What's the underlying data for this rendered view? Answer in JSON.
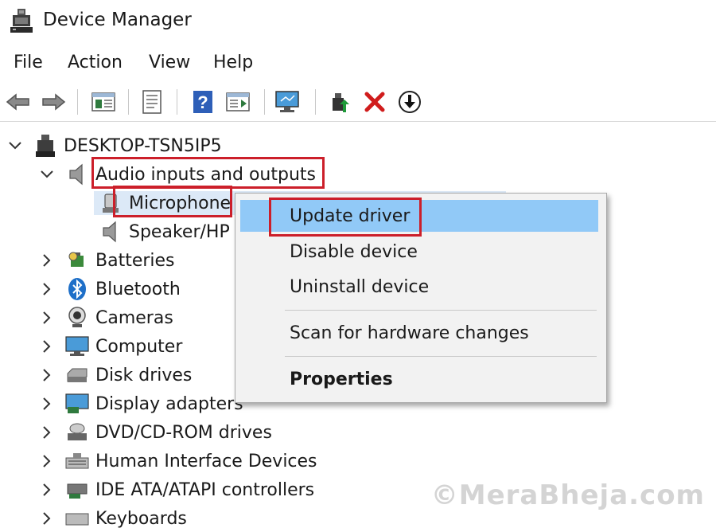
{
  "window": {
    "title": "Device Manager"
  },
  "menu": {
    "items": [
      "File",
      "Action",
      "View",
      "Help"
    ]
  },
  "toolbar": {
    "buttons": [
      "back-icon",
      "forward-icon",
      "show-hide-console-tree-icon",
      "properties-icon",
      "help-icon",
      "action-pane-icon",
      "monitor-icon",
      "update-driver-icon",
      "uninstall-icon",
      "disable-icon"
    ]
  },
  "tree": {
    "root": "DESKTOP-TSN5IP5",
    "audio": "Audio inputs and outputs",
    "microphone": "Microphone",
    "speaker": "Speaker/HP",
    "categories": [
      "Batteries",
      "Bluetooth",
      "Cameras",
      "Computer",
      "Disk drives",
      "Display adapters",
      "DVD/CD-ROM drives",
      "Human Interface Devices",
      "IDE ATA/ATAPI controllers",
      "Keyboards"
    ]
  },
  "context_menu": {
    "update_driver": "Update driver",
    "disable_device": "Disable device",
    "uninstall_device": "Uninstall device",
    "scan": "Scan for hardware changes",
    "properties": "Properties"
  },
  "watermark": "©MeraBheja.com",
  "colors": {
    "highlight_red": "#cc1f2a",
    "menu_hover": "#91c9f7",
    "selection": "#dce9f7"
  }
}
